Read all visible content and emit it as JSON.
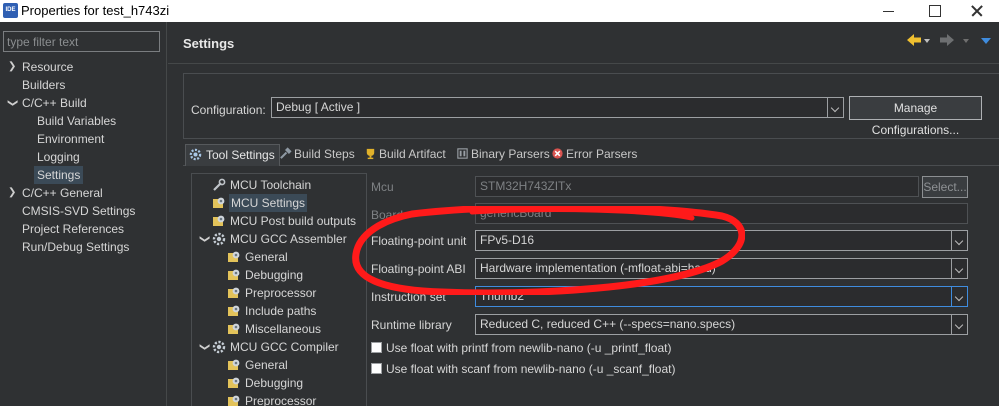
{
  "window": {
    "icon_text": "IDE",
    "title": "Properties for test_h743zi"
  },
  "filter": {
    "placeholder": "type filter text"
  },
  "sidebar": {
    "items": [
      {
        "label": "Resource",
        "expanded": false,
        "has_children": true
      },
      {
        "label": "Builders"
      },
      {
        "label": "C/C++ Build",
        "expanded": true,
        "has_children": true
      },
      {
        "label": "Build Variables"
      },
      {
        "label": "Environment"
      },
      {
        "label": "Logging"
      },
      {
        "label": "Settings",
        "selected": true
      },
      {
        "label": "C/C++ General",
        "expanded": false,
        "has_children": true
      },
      {
        "label": "CMSIS-SVD Settings"
      },
      {
        "label": "Project References"
      },
      {
        "label": "Run/Debug Settings"
      }
    ]
  },
  "header": {
    "title": "Settings"
  },
  "configuration": {
    "label": "Configuration:",
    "value": "Debug  [ Active ]",
    "manage_button": "Manage Configurations..."
  },
  "tabs": [
    {
      "label": "Tool Settings",
      "active": true,
      "icon": "gear-icon"
    },
    {
      "label": "Build Steps",
      "icon": "hammer-icon"
    },
    {
      "label": "Build Artifact",
      "icon": "trophy-icon"
    },
    {
      "label": "Binary Parsers",
      "icon": "binary-icon"
    },
    {
      "label": "Error Parsers",
      "icon": "error-icon"
    }
  ],
  "tool_tree": [
    {
      "label": "MCU Toolchain",
      "icon": "toolchain-icon"
    },
    {
      "label": "MCU Settings",
      "icon": "settings-icon",
      "selected": true
    },
    {
      "label": "MCU Post build outputs",
      "icon": "settings-icon"
    },
    {
      "label": "MCU GCC Assembler",
      "icon": "gear-icon",
      "expanded": true
    },
    {
      "label": "General",
      "icon": "settings-icon"
    },
    {
      "label": "Debugging",
      "icon": "settings-icon"
    },
    {
      "label": "Preprocessor",
      "icon": "settings-icon"
    },
    {
      "label": "Include paths",
      "icon": "settings-icon"
    },
    {
      "label": "Miscellaneous",
      "icon": "settings-icon"
    },
    {
      "label": "MCU GCC Compiler",
      "icon": "gear-icon",
      "expanded": true
    },
    {
      "label": "General",
      "icon": "settings-icon"
    },
    {
      "label": "Debugging",
      "icon": "settings-icon"
    },
    {
      "label": "Preprocessor",
      "icon": "settings-icon"
    }
  ],
  "form": {
    "mcu_label": "Mcu",
    "mcu_value": "STM32H743ZITx",
    "select_button": "Select...",
    "board_label": "Board",
    "board_value": "genericBoard",
    "fpu_label": "Floating-point unit",
    "fpu_value": "FPv5-D16",
    "abi_label": "Floating-point ABI",
    "abi_value": "Hardware implementation (-mfloat-abi=hard)",
    "instruction_label": "Instruction set",
    "instruction_value": "Thumb2",
    "runtime_label": "Runtime library",
    "runtime_value": "Reduced C, reduced C++ (--specs=nano.specs)",
    "printf_float_label": "Use float with printf from newlib-nano (-u _printf_float)",
    "printf_float_checked": false,
    "scanf_float_label": "Use float with scanf from newlib-nano (-u _scanf_float)",
    "scanf_float_checked": false
  },
  "colors": {
    "background": "#2f3133",
    "selection": "#3b4a57",
    "annotation": "#ff1a1a",
    "accent": "#3f8cde"
  }
}
